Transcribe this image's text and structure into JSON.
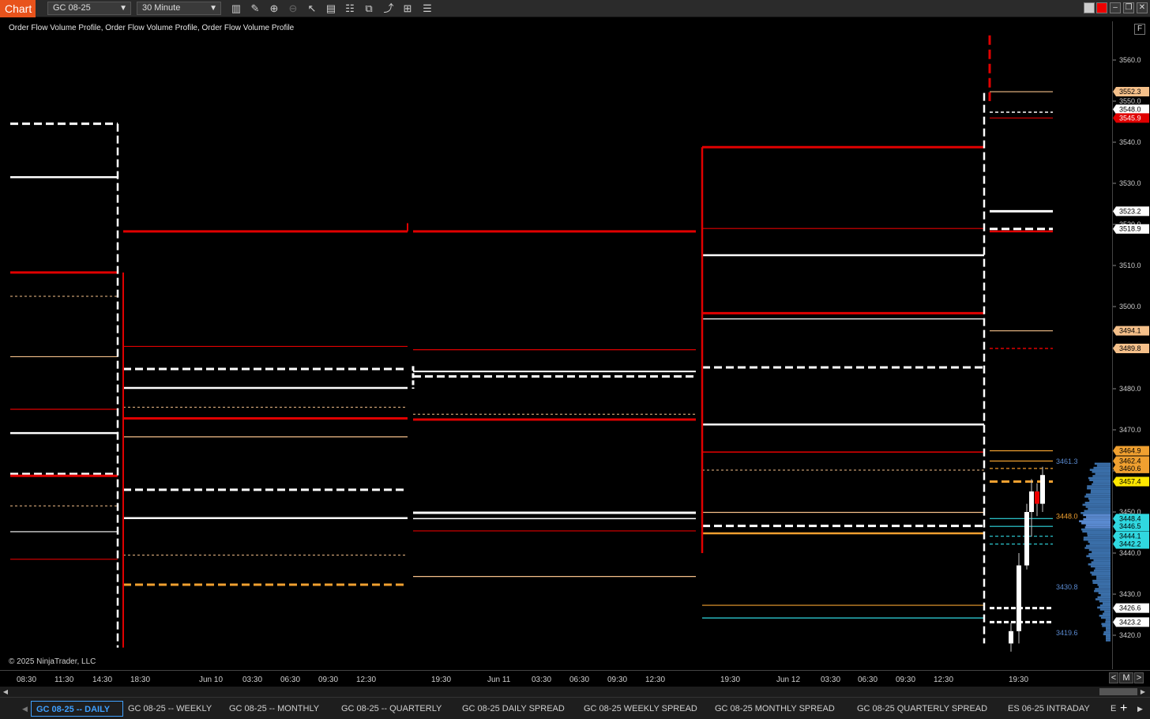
{
  "toolbar": {
    "chart_tab": "Chart",
    "instrument": "GC 08-25",
    "interval": "30 Minute",
    "icons": [
      "bar-type-icon",
      "pencil-icon",
      "zoom-in-icon",
      "zoom-out-icon",
      "pointer-icon",
      "data-box-icon",
      "properties-icon",
      "templates-icon",
      "strategies-icon",
      "indicators-icon",
      "list-icon"
    ],
    "window_controls": [
      "restore-icon",
      "red-icon",
      "minimize-icon",
      "maximize-icon",
      "close-icon"
    ]
  },
  "chart": {
    "indicator_label": "Order Flow Volume Profile, Order Flow Volume Profile, Order Flow Volume Profile",
    "copyright": "© 2025 NinjaTrader, LLC",
    "f_button": "F",
    "colors": {
      "background": "#000000",
      "white": "#ffffff",
      "red": "#e00000",
      "orange": "#f0a030",
      "peach": "#f5c08a",
      "cyan": "#30d8e0",
      "blue": "#3a6ea8"
    }
  },
  "price_axis": {
    "ticks": [
      "3560.0",
      "3550.0",
      "3540.0",
      "3530.0",
      "3520.0",
      "3510.0",
      "3500.0",
      "3490.0",
      "3480.0",
      "3470.0",
      "3460.0",
      "3450.0",
      "3440.0",
      "3430.0",
      "3420.0"
    ],
    "markers": [
      {
        "label": "3552.3",
        "color": "#f5c08a"
      },
      {
        "label": "3548.0",
        "color": "#ffffff"
      },
      {
        "label": "3545.9",
        "color": "#e00000"
      },
      {
        "label": "3523.2",
        "color": "#ffffff"
      },
      {
        "label": "3518.9",
        "color": "#ffffff"
      },
      {
        "label": "3494.1",
        "color": "#f5c08a"
      },
      {
        "label": "3489.8",
        "color": "#f5c08a"
      },
      {
        "label": "3464.9",
        "color": "#f0a030"
      },
      {
        "label": "3462.4",
        "color": "#f0a030"
      },
      {
        "label": "3460.6",
        "color": "#f0a030"
      },
      {
        "label": "3457.4",
        "color": "#ffe800"
      },
      {
        "label": "3448.4",
        "color": "#30d8e0"
      },
      {
        "label": "3446.5",
        "color": "#30d8e0"
      },
      {
        "label": "3444.1",
        "color": "#30d8e0"
      },
      {
        "label": "3442.2",
        "color": "#30d8e0"
      },
      {
        "label": "3426.6",
        "color": "#ffffff"
      },
      {
        "label": "3423.2",
        "color": "#ffffff"
      }
    ],
    "profile_labels": [
      {
        "label": "3461.3",
        "color": "#5a8ad0"
      },
      {
        "label": "3448.0",
        "color": "#f0a030"
      },
      {
        "label": "3430.8",
        "color": "#5a8ad0"
      },
      {
        "label": "3419.6",
        "color": "#5a8ad0"
      }
    ]
  },
  "time_axis": {
    "labels": [
      "08:30",
      "11:30",
      "14:30",
      "18:30",
      "Jun 10",
      "03:30",
      "06:30",
      "09:30",
      "12:30",
      "19:30",
      "Jun 11",
      "03:30",
      "06:30",
      "09:30",
      "12:30",
      "19:30",
      "Jun 12",
      "03:30",
      "06:30",
      "09:30",
      "12:30",
      "19:30"
    ],
    "controls": [
      "<",
      "M",
      ">"
    ]
  },
  "tabs": [
    {
      "label": "GC 08-25 -- DAILY",
      "active": true
    },
    {
      "label": "GC 08-25 -- WEEKLY"
    },
    {
      "label": "GC 08-25 -- MONTHLY"
    },
    {
      "label": "GC 08-25 -- QUARTERLY"
    },
    {
      "label": "GC 08-25 DAILY SPREAD"
    },
    {
      "label": "GC 08-25 WEEKLY SPREAD"
    },
    {
      "label": "GC 08-25 MONTHLY SPREAD"
    },
    {
      "label": "GC 08-25 QUARTERLY SPREAD"
    },
    {
      "label": "ES 06-25 INTRADAY"
    },
    {
      "label": "E"
    }
  ],
  "tab_controls": [
    "add-tab-icon",
    "scroll-tabs-right-icon"
  ]
}
